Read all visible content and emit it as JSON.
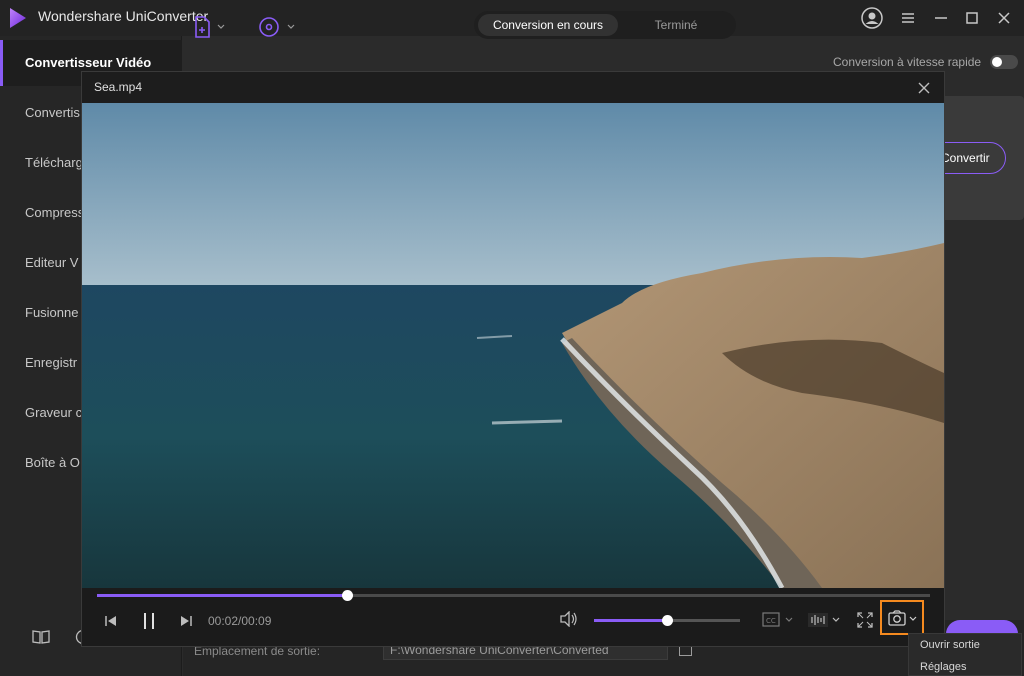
{
  "app": {
    "title": "Wondershare UniConverter"
  },
  "sidebar": {
    "active_label": "Convertisseur Vidéo",
    "items": [
      "Convertis",
      "Télécharg",
      "Compress",
      "Editeur V",
      "Fusionne",
      "Enregistr",
      "Graveur c",
      "Boîte à O"
    ]
  },
  "tabs": {
    "active": "Conversion en cours",
    "inactive": "Terminé"
  },
  "speed_label": "Conversion à vitesse rapide",
  "speed_toggle_on": false,
  "card": {
    "convert_label": "Convertir"
  },
  "output": {
    "location_label": "Emplacement de sortie:",
    "location_value": "F:\\Wondershare UniConverter\\Converted"
  },
  "player": {
    "title": "Sea.mp4",
    "time": "00:02/00:09",
    "progress": 0.3,
    "volume": 0.5
  },
  "snapshot_menu": {
    "items": [
      "Ouvrir sortie",
      "Réglages"
    ]
  },
  "colors": {
    "accent": "#8a5cf6",
    "highlight": "#f58a1f"
  }
}
